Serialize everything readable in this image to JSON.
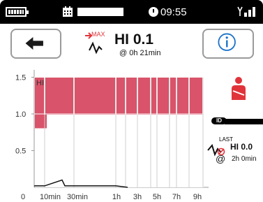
{
  "status": {
    "time": "09:55",
    "icons": [
      "battery-icon",
      "calendar-icon",
      "clock-icon",
      "signal-icon"
    ]
  },
  "toolbar": {
    "back_icon": "arrow-left-icon",
    "info_icon": "info-icon"
  },
  "reading_max": {
    "tag": "MAX",
    "value": "HI 0.1",
    "at": "@ 0h 21min"
  },
  "reading_last": {
    "tag": "LAST",
    "value": "HI 0.0",
    "at": "@",
    "time": "2h 0min"
  },
  "id_label": "ID",
  "colors": {
    "bar": "#d9536a",
    "accent": "#e0343a",
    "info": "#1a72c9"
  },
  "chart_data": {
    "type": "bar",
    "y_axis_title": "HI",
    "ylim": [
      0,
      1.6
    ],
    "yticks": [
      "1.5",
      "1.0",
      "0.5"
    ],
    "ytick_values": [
      1.5,
      1.0,
      0.5
    ],
    "xticks": [
      "0",
      "10min",
      "30min",
      "1h",
      "3h",
      "5h",
      "7h",
      "9h"
    ],
    "bars": [
      {
        "from": "0",
        "to": "10min",
        "value": 1.5
      },
      {
        "from": "0",
        "to": "10min",
        "value": 0.9
      },
      {
        "from": "10min",
        "to": "30min",
        "value": 1.5
      },
      {
        "from": "30min",
        "to": "1h",
        "value": 1.5
      },
      {
        "from": "1h",
        "to": "1.5h",
        "value": 1.5
      },
      {
        "from": "1.5h",
        "to": "3h",
        "value": 1.5
      },
      {
        "from": "3h",
        "to": "4h",
        "value": 1.5
      },
      {
        "from": "4h",
        "to": "5h",
        "value": 1.5
      },
      {
        "from": "5h",
        "to": "6h",
        "value": 1.5
      },
      {
        "from": "6h",
        "to": "7h",
        "value": 1.5
      },
      {
        "from": "7h",
        "to": "8h",
        "value": 1.5
      },
      {
        "from": "8h",
        "to": "9h",
        "value": 1.5
      }
    ],
    "trace": [
      {
        "x": "0",
        "y": 0.02
      },
      {
        "x": "10min",
        "y": 0.02
      },
      {
        "x": "18min",
        "y": 0.1
      },
      {
        "x": "21min",
        "y": 0.02
      },
      {
        "x": "30min",
        "y": 0.02
      },
      {
        "x": "1h",
        "y": 0.02
      },
      {
        "x": "2h",
        "y": 0.0
      }
    ],
    "grid": true
  }
}
